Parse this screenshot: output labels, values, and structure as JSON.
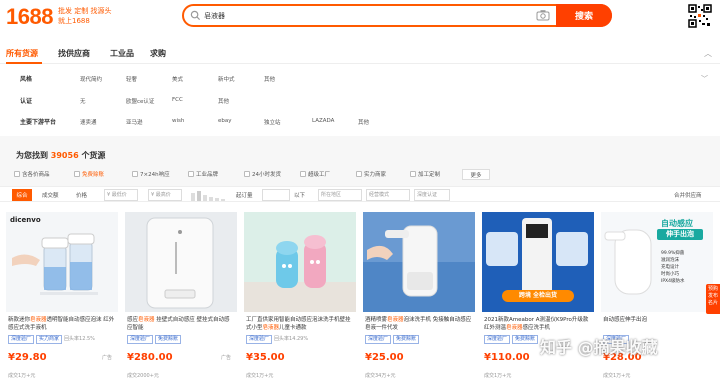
{
  "header": {
    "logo": "1688",
    "slogan_line1": "批发 定制 找源头",
    "slogan_line2": "就上1688",
    "search_value": "皂液器",
    "search_button": "搜索"
  },
  "tabs": [
    {
      "label": "所有货源",
      "active": true
    },
    {
      "label": "找供应商",
      "active": false
    },
    {
      "label": "工业品",
      "active": false
    },
    {
      "label": "求购",
      "active": false
    }
  ],
  "filters": [
    {
      "label": "风格",
      "options": [
        "现代简约",
        "轻奢",
        "美式",
        "新中式",
        "其他"
      ]
    },
    {
      "label": "认证",
      "options": [
        "无",
        "欧盟ce认证",
        "FCC",
        "其他"
      ]
    },
    {
      "label": "主要下游平台",
      "options": [
        "速卖通",
        "亚马逊",
        "wish",
        "ebay",
        "独立站",
        "LAZADA",
        "其他"
      ]
    }
  ],
  "results": {
    "prefix": "为您找到",
    "count": "39056",
    "suffix": "个货源"
  },
  "checks": [
    {
      "label": "含各价商品",
      "highlight": false
    },
    {
      "label": "免费赊账",
      "highlight": true
    },
    {
      "label": "7×24h响应",
      "highlight": false
    },
    {
      "label": "工业品牌",
      "highlight": false
    },
    {
      "label": "24小时发货",
      "highlight": false
    },
    {
      "label": "超级工厂",
      "highlight": false
    },
    {
      "label": "实力商家",
      "highlight": false
    },
    {
      "label": "加工定制",
      "highlight": false
    }
  ],
  "more_label": "更多",
  "sort": {
    "active": "综合",
    "items": [
      "成交额",
      "价格"
    ],
    "price_min": "¥ 最低价",
    "price_max": "¥ 最高价",
    "moq_label": "起订量",
    "moq_unit": "以下",
    "location": "所在地区",
    "model": "经营模式",
    "depth": "深度认证",
    "compare": "合并供应商"
  },
  "products": [
    {
      "title_pre": "新款迷你",
      "title_kw": "皂液器",
      "title_post": "透明智能自动感应泡沫 红外感应式洗手液机",
      "tags": [
        "深度验厂",
        "实力商家"
      ],
      "extra": "回头率12.5%",
      "price": "29.80",
      "sold": "成交1万+元",
      "ad": "广告"
    },
    {
      "title_pre": "感应",
      "title_kw": "皂液器",
      "title_post": " 挂壁式自动感应 壁挂式自动感应智能",
      "tags": [
        "深度验厂",
        "免费赊账"
      ],
      "extra": "",
      "price": "280.00",
      "sold": "成交2000+元",
      "ad": "广告"
    },
    {
      "title_pre": "工厂直供家用智能自动感应泡沫洗手机壁挂式小型",
      "title_kw": "皂液器",
      "title_post": "儿童卡通款",
      "tags": [
        "深度验厂"
      ],
      "extra": "回头率14.29%",
      "price": "35.00",
      "sold": "成交1万+元",
      "ad": ""
    },
    {
      "title_pre": "酒精喷雾",
      "title_kw": "皂液器",
      "title_post": "泡沫洗手机 免接触自动感应皂液一件代发",
      "tags": [
        "深度验厂",
        "免费赊账"
      ],
      "extra": "",
      "price": "25.00",
      "sold": "成交34万+元",
      "ad": ""
    },
    {
      "title_pre": "2021新款Ameabor A测温仪K9Pro升级款红外测温",
      "title_kw": "皂液器",
      "title_post": "感应洗手机",
      "tags": [
        "深度验厂",
        "免费赊账"
      ],
      "extra": "",
      "price": "110.00",
      "sold": "成交1万+元",
      "ad": ""
    },
    {
      "title_pre": "自动感应伸手出泡",
      "title_kw": "",
      "title_post": "",
      "tags": [
        "深度验厂"
      ],
      "extra": "",
      "price": "28.00",
      "sold": "成交1万+元",
      "ad": ""
    }
  ],
  "product_badges": {
    "p5_overlay": "跨境 全检出货",
    "p6_overlay1": "自动感应",
    "p6_overlay2": "伸手出泡",
    "p6_features": [
      "99.9%抑菌",
      "滋润泡沫",
      "充电设计",
      "时尚小巧",
      "IPX4级防水"
    ]
  },
  "watermark": "知乎 @摘果收藏",
  "side_float": "预购 发布 名片",
  "logo_text": "dicenvo",
  "colors": {
    "accent": "#ff5a00",
    "button": "#ff4000",
    "link": "#3366cc"
  }
}
